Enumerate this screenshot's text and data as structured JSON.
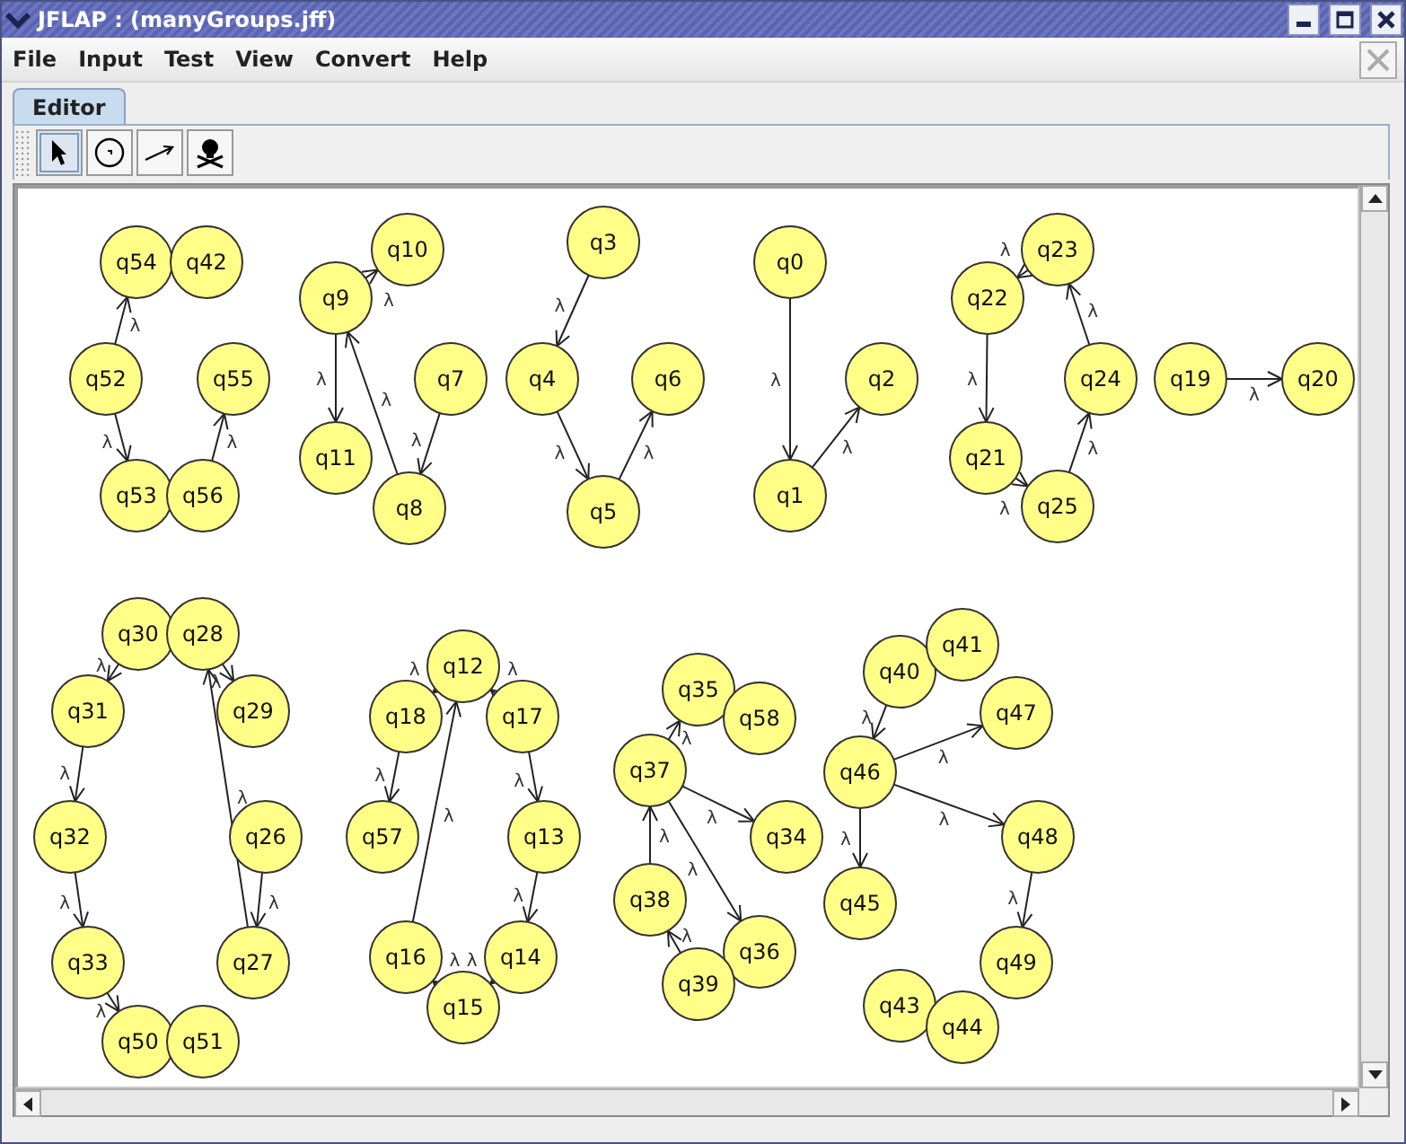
{
  "window": {
    "title": "JFLAP : (manyGroups.jff)"
  },
  "menu": [
    "File",
    "Input",
    "Test",
    "View",
    "Convert",
    "Help"
  ],
  "tabs": [
    {
      "label": "Editor",
      "selected": true
    }
  ],
  "tools": [
    {
      "kind": "pointer",
      "selected": true
    },
    {
      "kind": "state",
      "selected": false
    },
    {
      "kind": "transition",
      "selected": false
    },
    {
      "kind": "delete",
      "selected": false
    }
  ],
  "states": [
    "q54",
    "q42",
    "q52",
    "q55",
    "q53",
    "q56",
    "q10",
    "q9",
    "q7",
    "q11",
    "q8",
    "q3",
    "q4",
    "q6",
    "q5",
    "q0",
    "q2",
    "q1",
    "q23",
    "q22",
    "q24",
    "q21",
    "q25",
    "q19",
    "q20",
    "q30",
    "q28",
    "q31",
    "q29",
    "q32",
    "q26",
    "q33",
    "q27",
    "q50",
    "q51",
    "q12",
    "q18",
    "q17",
    "q57",
    "q13",
    "q16",
    "q14",
    "q15",
    "q35",
    "q58",
    "q37",
    "q34",
    "q38",
    "q36",
    "q39",
    "q40",
    "q41",
    "q47",
    "q46",
    "q48",
    "q45",
    "q49",
    "q43",
    "q44"
  ],
  "transitions": [
    "λ",
    "λ",
    "λ",
    "λ",
    "λ",
    "λ",
    "λ",
    "λ",
    "λ",
    "λ",
    "λ",
    "λ",
    "λ",
    "λ",
    "λ",
    "λ",
    "λ",
    "λ",
    "λ",
    "λ",
    "λ",
    "λ",
    "λ",
    "λ",
    "λ",
    "λ",
    "λ",
    "λ",
    "λ",
    "λ",
    "λ",
    "λ",
    "λ",
    "λ",
    "λ",
    "λ",
    "λ",
    "λ",
    "λ",
    "λ",
    "λ",
    "λ",
    "λ"
  ]
}
